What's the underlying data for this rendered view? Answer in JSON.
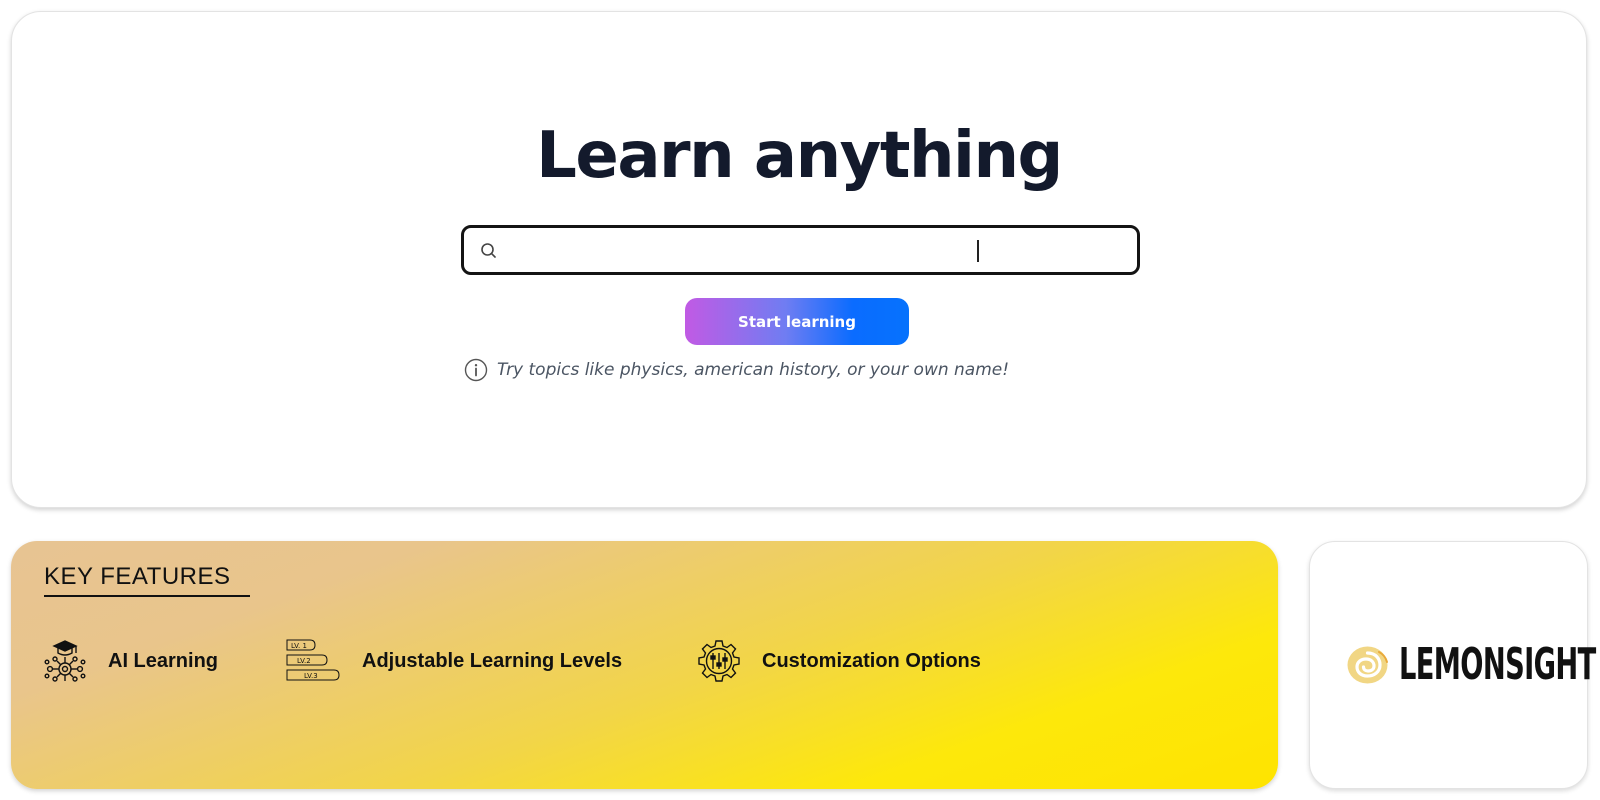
{
  "hero": {
    "title": "Learn anything",
    "search": {
      "value": "",
      "placeholder": ""
    },
    "start_button_label": "Start learning",
    "hint": "Try topics like physics, american history, or your own name!"
  },
  "features": {
    "heading": "KEY FEATURES",
    "items": [
      {
        "label": "AI Learning",
        "icon": "ai-learning-icon"
      },
      {
        "label": "Adjustable Learning Levels",
        "icon": "learning-levels-icon",
        "levels": [
          "LV. 1",
          "LV.2",
          "LV.3"
        ]
      },
      {
        "label": "Customization Options",
        "icon": "customization-gear-icon"
      }
    ]
  },
  "brand": {
    "name": "LEMONSIGHT",
    "logo_icon": "lemon-swirl-icon"
  },
  "colors": {
    "title": "#131a2c",
    "button_gradient_start": "#c15ae4",
    "button_gradient_end": "#0672fd",
    "features_gradient_start": "#e7c493",
    "features_gradient_end": "#fee300",
    "logo_swirl": "#f3d98a"
  }
}
